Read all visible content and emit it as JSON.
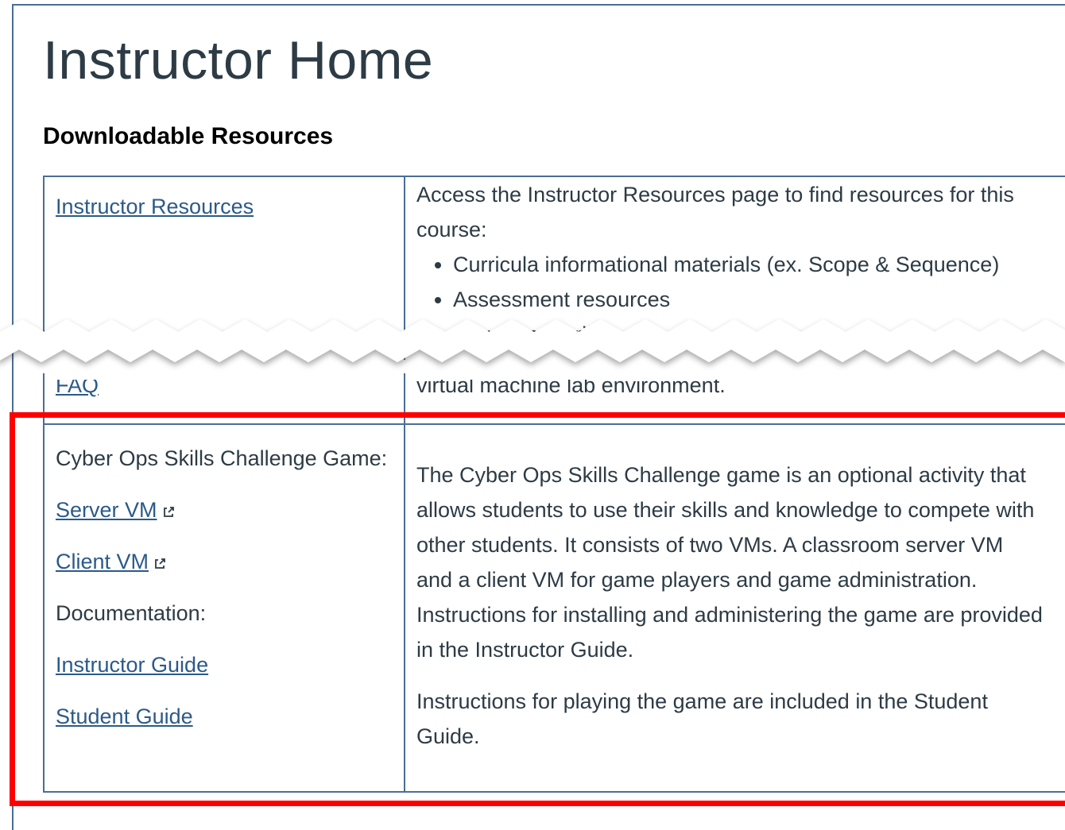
{
  "page": {
    "title": "Instructor Home",
    "section_heading": "Downloadable Resources"
  },
  "row1": {
    "link_label": "Instructor Resources",
    "description": "Access the Instructor Resources page to find resources for this course:",
    "bullets": [
      "Curricula informational materials (ex. Scope & Sequence)",
      "Assessment resources",
      "Source materials"
    ]
  },
  "row2_fragment": {
    "link_label": "FAQ",
    "description": "virtual machine lab environment."
  },
  "game_row": {
    "title": "Cyber Ops Skills Challenge Game:",
    "server_vm_label": "Server VM",
    "client_vm_label": "Client VM",
    "documentation_label": "Documentation:",
    "instructor_guide_label": "Instructor Guide",
    "student_guide_label": "Student Guide",
    "description_1": "The Cyber Ops Skills Challenge game is an optional activity that allows students to use their skills and knowledge to compete with other students. It consists of two VMs. A classroom server VM and a client VM for game players and game administration. Instructions for installing and administering the game are provided in the Instructor Guide.",
    "description_2": "Instructions for playing the game are included in the Student Guide."
  },
  "icons": {
    "external_link": "external-link-icon"
  },
  "colors": {
    "link": "#2b5a8a",
    "table_border": "#4a6e96",
    "highlight": "#ff0000",
    "text": "#2d3b45"
  }
}
